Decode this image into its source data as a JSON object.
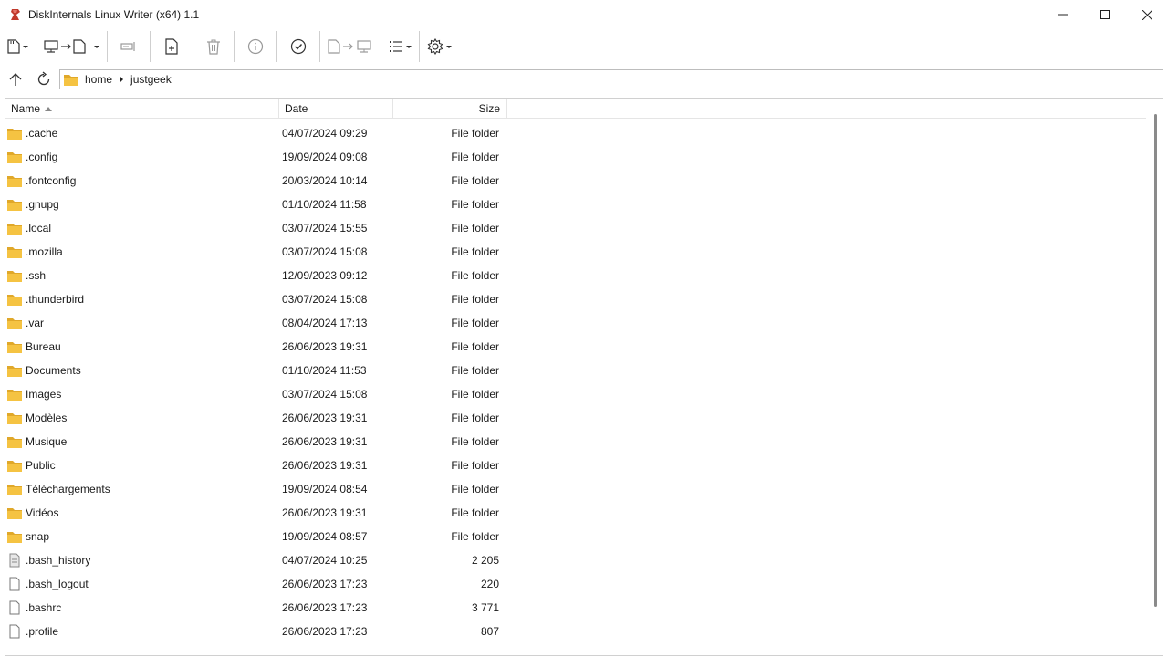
{
  "window": {
    "title": "DiskInternals Linux Writer (x64) 1.1"
  },
  "address": {
    "crumbs": [
      "home",
      "justgeek"
    ]
  },
  "columns": {
    "name": "Name",
    "date": "Date",
    "size": "Size"
  },
  "files": [
    {
      "name": ".cache",
      "date": "04/07/2024 09:29",
      "size": "File folder",
      "type": "folder"
    },
    {
      "name": ".config",
      "date": "19/09/2024 09:08",
      "size": "File folder",
      "type": "folder"
    },
    {
      "name": ".fontconfig",
      "date": "20/03/2024 10:14",
      "size": "File folder",
      "type": "folder"
    },
    {
      "name": ".gnupg",
      "date": "01/10/2024 11:58",
      "size": "File folder",
      "type": "folder"
    },
    {
      "name": ".local",
      "date": "03/07/2024 15:55",
      "size": "File folder",
      "type": "folder"
    },
    {
      "name": ".mozilla",
      "date": "03/07/2024 15:08",
      "size": "File folder",
      "type": "folder"
    },
    {
      "name": ".ssh",
      "date": "12/09/2023 09:12",
      "size": "File folder",
      "type": "folder"
    },
    {
      "name": ".thunderbird",
      "date": "03/07/2024 15:08",
      "size": "File folder",
      "type": "folder"
    },
    {
      "name": ".var",
      "date": "08/04/2024 17:13",
      "size": "File folder",
      "type": "folder"
    },
    {
      "name": "Bureau",
      "date": "26/06/2023 19:31",
      "size": "File folder",
      "type": "folder"
    },
    {
      "name": "Documents",
      "date": "01/10/2024 11:53",
      "size": "File folder",
      "type": "folder"
    },
    {
      "name": "Images",
      "date": "03/07/2024 15:08",
      "size": "File folder",
      "type": "folder"
    },
    {
      "name": "Modèles",
      "date": "26/06/2023 19:31",
      "size": "File folder",
      "type": "folder"
    },
    {
      "name": "Musique",
      "date": "26/06/2023 19:31",
      "size": "File folder",
      "type": "folder"
    },
    {
      "name": "Public",
      "date": "26/06/2023 19:31",
      "size": "File folder",
      "type": "folder"
    },
    {
      "name": "Téléchargements",
      "date": "19/09/2024 08:54",
      "size": "File folder",
      "type": "folder"
    },
    {
      "name": "Vidéos",
      "date": "26/06/2023 19:31",
      "size": "File folder",
      "type": "folder"
    },
    {
      "name": "snap",
      "date": "19/09/2024 08:57",
      "size": "File folder",
      "type": "folder"
    },
    {
      "name": ".bash_history",
      "date": "04/07/2024 10:25",
      "size": "2 205",
      "type": "history"
    },
    {
      "name": ".bash_logout",
      "date": "26/06/2023 17:23",
      "size": "220",
      "type": "file"
    },
    {
      "name": ".bashrc",
      "date": "26/06/2023 17:23",
      "size": "3 771",
      "type": "file"
    },
    {
      "name": ".profile",
      "date": "26/06/2023 17:23",
      "size": "807",
      "type": "file"
    }
  ],
  "colors": {
    "folder": "#f5c342",
    "folder_dark": "#e0a82a",
    "app_icon": "#c0392b"
  }
}
